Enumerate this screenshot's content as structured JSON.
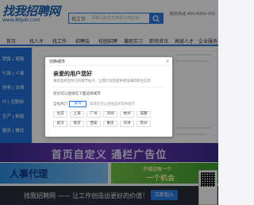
{
  "site": {
    "logo_text": "找我招聘网",
    "logo_sub": "www.89job.com"
  },
  "search": {
    "type_label": "找工作",
    "placeholder": "请输入职位名称或公司名称"
  },
  "hotline": "服务热线 400-0000-000",
  "nav": {
    "items": [
      "首页",
      "找人才",
      "找工作",
      "招聘会",
      "校园招聘",
      "兼职实习",
      "职场资讯",
      "高级人才",
      "企业服务"
    ]
  },
  "sidebar": {
    "items": [
      "销售 | 客服",
      "行政 | 人事",
      "财务 | 法律",
      "IT | 互联网",
      "生产 | 制造",
      "服务 | 餐饮"
    ]
  },
  "banners": {
    "top": "首页自定义 通栏广告位",
    "left": "人事代理",
    "right_small": "不错过每一个",
    "right_big": "一个机会"
  },
  "footer": {
    "text": "找我招聘网 —— 让工作创造出更好的价值！",
    "button": "立即加入"
  },
  "modal": {
    "title": "切换城市",
    "close_glyph": "×",
    "heading": "亲爱的用户您好",
    "description": "请您选择您所在的城市站点，让我们为您提供更准确的职位信息",
    "section_label": "您也可以直接在下面选择城市",
    "row_label": "全省热门",
    "selected_city": "某市",
    "row_hint": "或者您可以直接选择其他城市",
    "cities": [
      "北京",
      "上海",
      "广州",
      "深圳",
      "杭州",
      "成都",
      "武汉",
      "南京",
      "西安",
      "重庆",
      "天津",
      "苏州",
      "长沙",
      "郑州",
      "青岛"
    ]
  }
}
